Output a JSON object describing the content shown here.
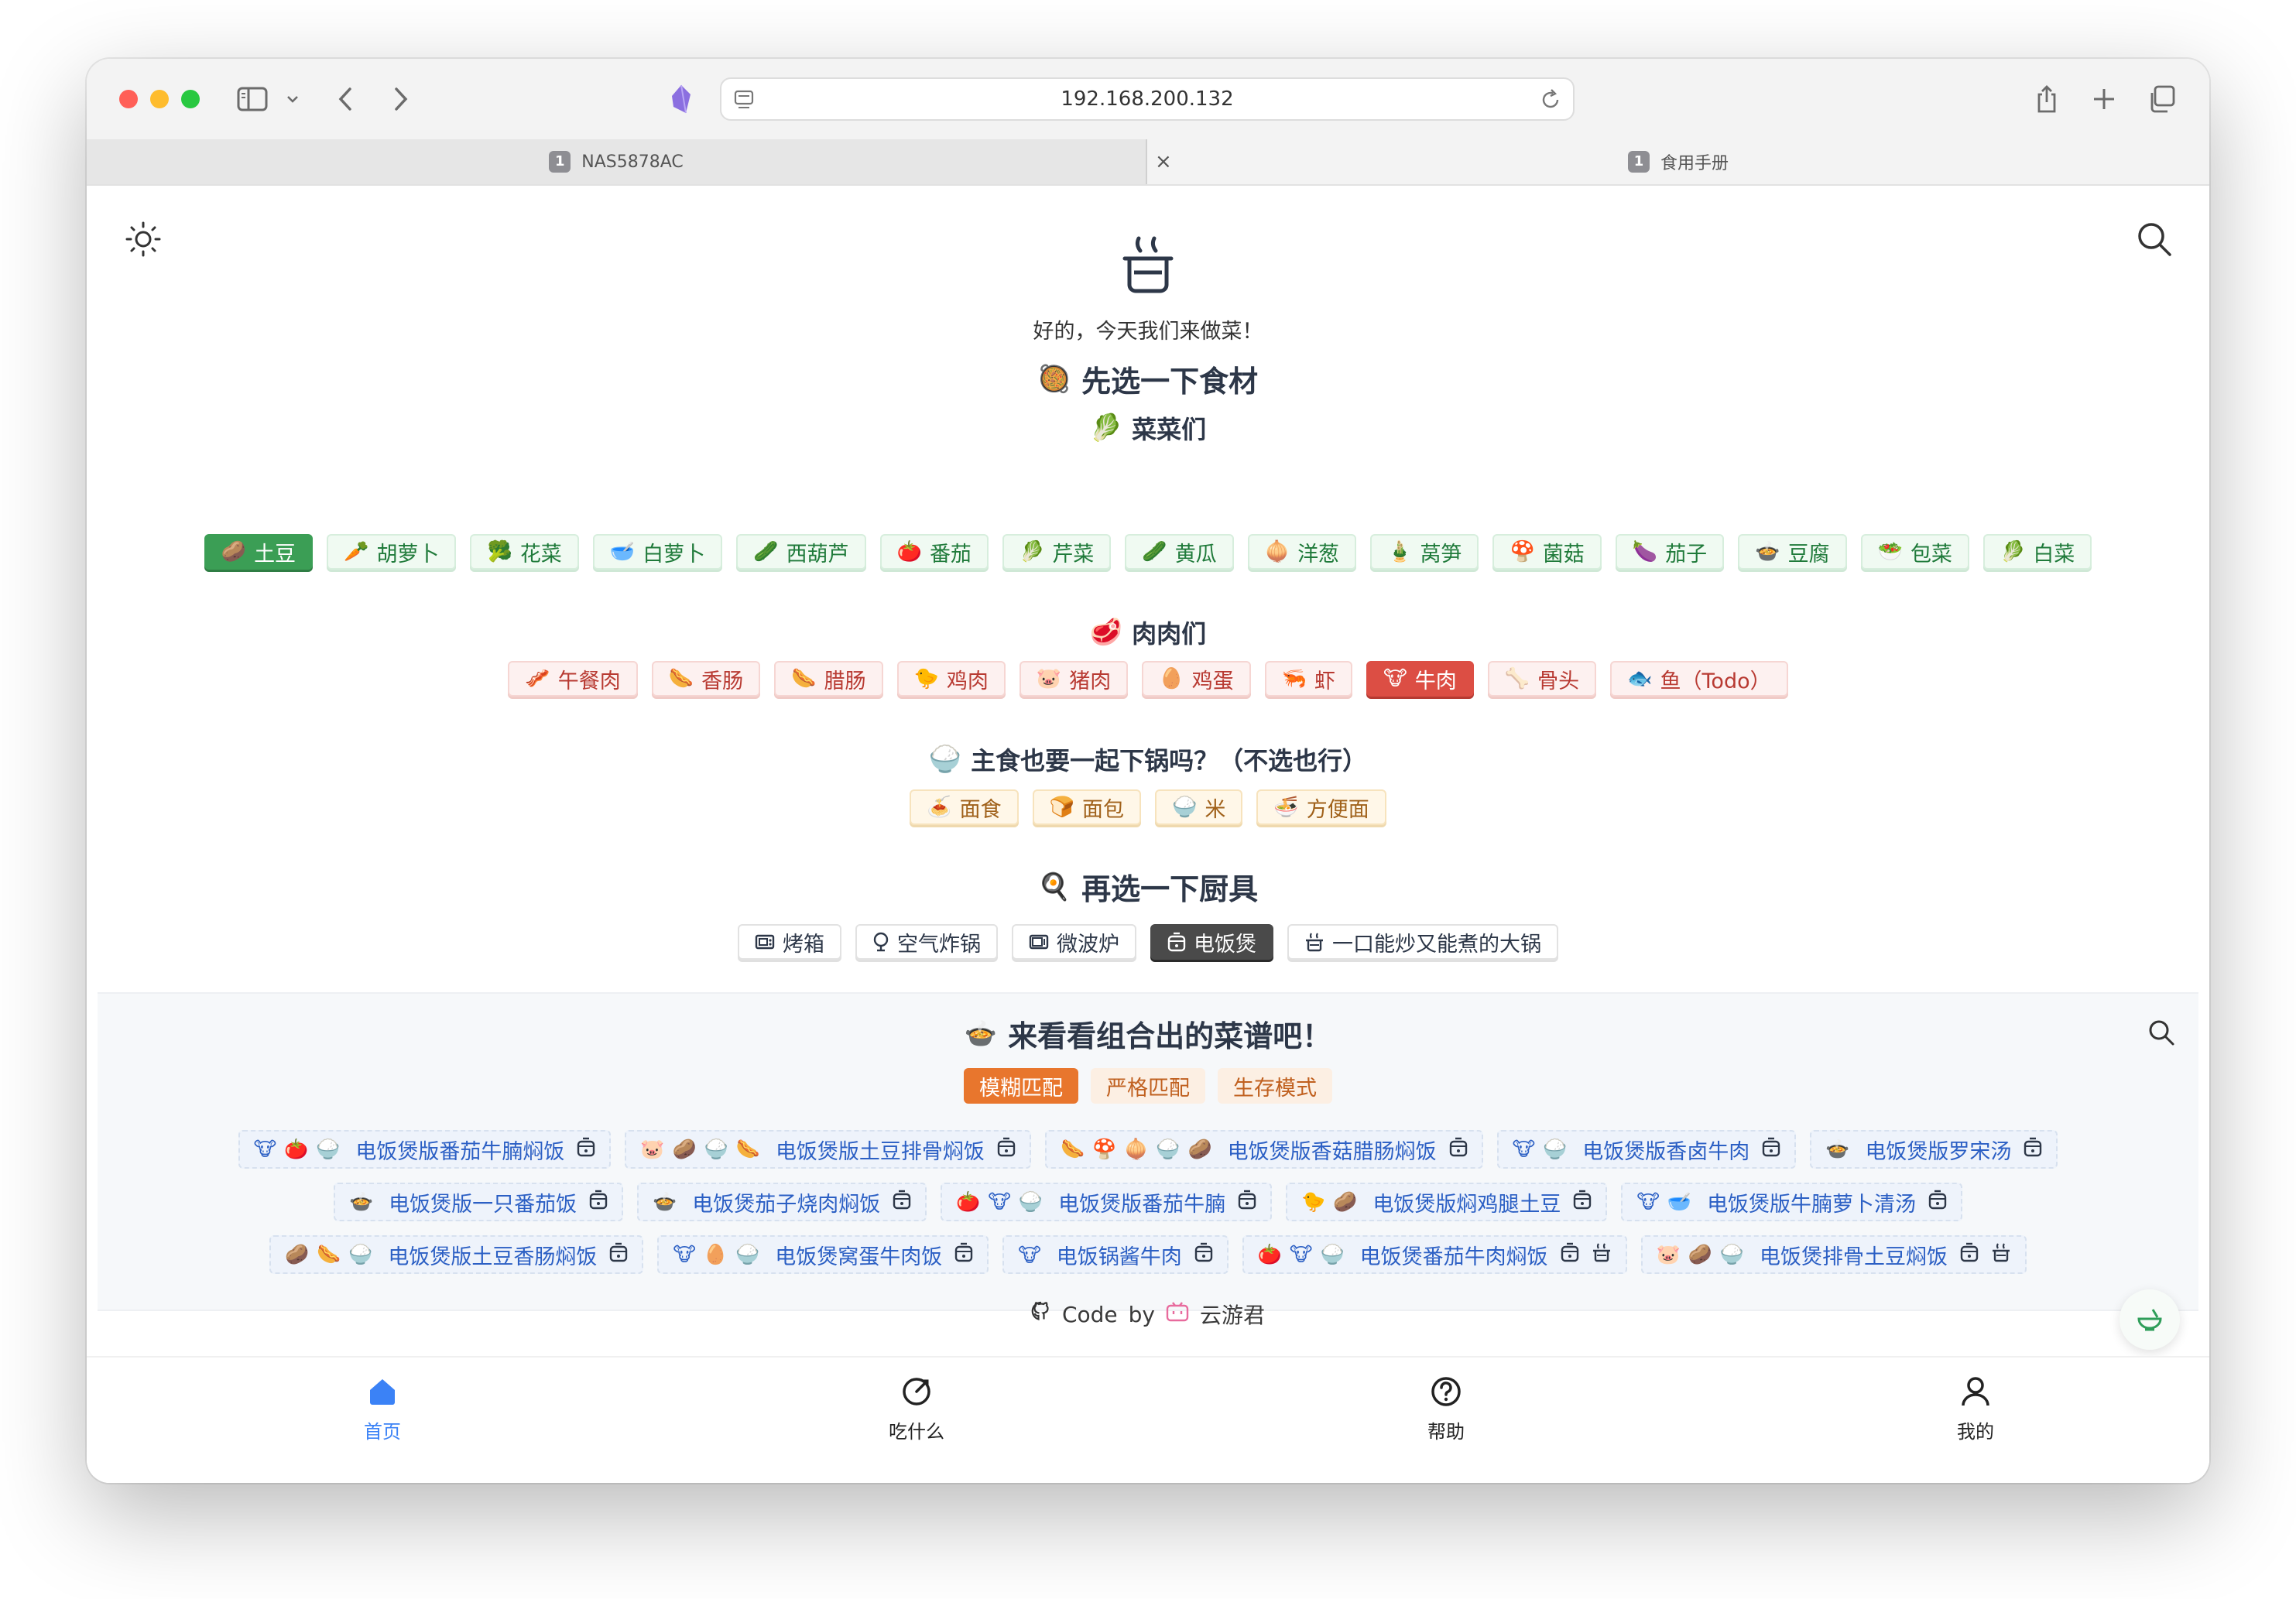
{
  "browser": {
    "url": "192.168.200.132",
    "tabs": [
      {
        "number": "1",
        "title": "NAS5878AC"
      },
      {
        "number": "1",
        "title": "食用手册"
      }
    ]
  },
  "page": {
    "greeting": "好的，今天我们来做菜！",
    "ingredients_title": "先选一下食材",
    "ingredients_emoji": "🥘",
    "vegetables": {
      "title": "菜菜们",
      "emoji": "🥬",
      "items": [
        {
          "emoji": "🥔",
          "label": "土豆",
          "selected": true
        },
        {
          "emoji": "🥕",
          "label": "胡萝卜",
          "selected": false
        },
        {
          "emoji": "🥦",
          "label": "花菜",
          "selected": false
        },
        {
          "emoji": "🥣",
          "label": "白萝卜",
          "selected": false
        },
        {
          "emoji": "🥒",
          "label": "西葫芦",
          "selected": false
        },
        {
          "emoji": "🍅",
          "label": "番茄",
          "selected": false
        },
        {
          "emoji": "🥬",
          "label": "芹菜",
          "selected": false
        },
        {
          "emoji": "🥒",
          "label": "黄瓜",
          "selected": false
        },
        {
          "emoji": "🧅",
          "label": "洋葱",
          "selected": false
        },
        {
          "emoji": "🎍",
          "label": "莴笋",
          "selected": false
        },
        {
          "emoji": "🍄",
          "label": "菌菇",
          "selected": false
        },
        {
          "emoji": "🍆",
          "label": "茄子",
          "selected": false
        },
        {
          "emoji": "🍲",
          "label": "豆腐",
          "selected": false
        },
        {
          "emoji": "🥗",
          "label": "包菜",
          "selected": false
        },
        {
          "emoji": "🥬",
          "label": "白菜",
          "selected": false
        }
      ]
    },
    "meats": {
      "title": "肉肉们",
      "emoji": "🥩",
      "items": [
        {
          "emoji": "🥓",
          "label": "午餐肉",
          "selected": false
        },
        {
          "emoji": "🌭",
          "label": "香肠",
          "selected": false
        },
        {
          "emoji": "🌭",
          "label": "腊肠",
          "selected": false
        },
        {
          "emoji": "🐤",
          "label": "鸡肉",
          "selected": false
        },
        {
          "emoji": "🐷",
          "label": "猪肉",
          "selected": false
        },
        {
          "emoji": "🥚",
          "label": "鸡蛋",
          "selected": false
        },
        {
          "emoji": "🦐",
          "label": "虾",
          "selected": false
        },
        {
          "emoji": "🐮",
          "label": "牛肉",
          "selected": true
        },
        {
          "emoji": "🦴",
          "label": "骨头",
          "selected": false
        },
        {
          "emoji": "🐟",
          "label": "鱼（Todo）",
          "selected": false
        }
      ]
    },
    "staples": {
      "title": "主食也要一起下锅吗？（不选也行）",
      "emoji": "🍚",
      "items": [
        {
          "emoji": "🍝",
          "label": "面食"
        },
        {
          "emoji": "🍞",
          "label": "面包"
        },
        {
          "emoji": "🍚",
          "label": "米"
        },
        {
          "emoji": "🍜",
          "label": "方便面"
        }
      ]
    },
    "tools": {
      "title": "再选一下厨具",
      "emoji": "🍳",
      "items": [
        {
          "icon": "oven-icon",
          "label": "烤箱",
          "selected": false
        },
        {
          "icon": "air-fryer-icon",
          "label": "空气炸锅",
          "selected": false
        },
        {
          "icon": "microwave-icon",
          "label": "微波炉",
          "selected": false
        },
        {
          "icon": "rice-cooker-icon",
          "label": "电饭煲",
          "selected": true
        },
        {
          "icon": "pot-icon",
          "label": "一口能炒又能煮的大锅",
          "selected": false
        }
      ]
    },
    "results": {
      "title": "来看看组合出的菜谱吧！",
      "emoji": "🍲",
      "modes": [
        {
          "label": "模糊匹配",
          "selected": true
        },
        {
          "label": "严格匹配",
          "selected": false
        },
        {
          "label": "生存模式",
          "selected": false
        }
      ],
      "rows": [
        [
          {
            "emojis": "🐮🍅🍚",
            "label": "电饭煲版番茄牛腩焖饭"
          },
          {
            "emojis": "🐷🥔🍚🌭",
            "label": "电饭煲版土豆排骨焖饭"
          },
          {
            "emojis": "🌭🍄🧅🍚🥔",
            "label": "电饭煲版香菇腊肠焖饭"
          },
          {
            "emojis": "🐮🍚",
            "label": "电饭煲版香卤牛肉"
          },
          {
            "emojis": "🍲",
            "label": "电饭煲版罗宋汤"
          }
        ],
        [
          {
            "emojis": "🍲",
            "label": "电饭煲版一只番茄饭"
          },
          {
            "emojis": "🍲",
            "label": "电饭煲茄子烧肉焖饭"
          },
          {
            "emojis": "🍅🐮🍚",
            "label": "电饭煲版番茄牛腩"
          },
          {
            "emojis": "🐤🥔",
            "label": "电饭煲版焖鸡腿土豆"
          },
          {
            "emojis": "🐮🥣",
            "label": "电饭煲版牛腩萝卜清汤"
          }
        ],
        [
          {
            "emojis": "🥔🌭🍚",
            "label": "电饭煲版土豆香肠焖饭"
          },
          {
            "emojis": "🐮🥚🍚",
            "label": "电饭煲窝蛋牛肉饭"
          },
          {
            "emojis": "🐮",
            "label": "电饭锅酱牛肉"
          },
          {
            "emojis": "🍅🐮🍚",
            "label": "电饭煲番茄牛肉焖饭",
            "extra_pot": true
          },
          {
            "emojis": "🐷🥔🍚",
            "label": "电饭煲排骨土豆焖饭",
            "extra_pot": true
          }
        ]
      ]
    },
    "footer": {
      "code": "Code",
      "by": "by",
      "author": "云游君"
    },
    "nav": [
      {
        "label": "首页",
        "icon": "home-icon",
        "active": true
      },
      {
        "label": "吃什么",
        "icon": "dice-icon",
        "active": false
      },
      {
        "label": "帮助",
        "icon": "help-icon",
        "active": false
      },
      {
        "label": "我的",
        "icon": "user-icon",
        "active": false
      }
    ]
  },
  "colors": {
    "accent_blue": "#3b82f6",
    "veg_selected": "#3b9e55",
    "meat_selected": "#dc4e44",
    "tool_selected": "#4a4a4a",
    "mode_selected": "#e8762d",
    "recipe_text": "#2b5fc4"
  }
}
